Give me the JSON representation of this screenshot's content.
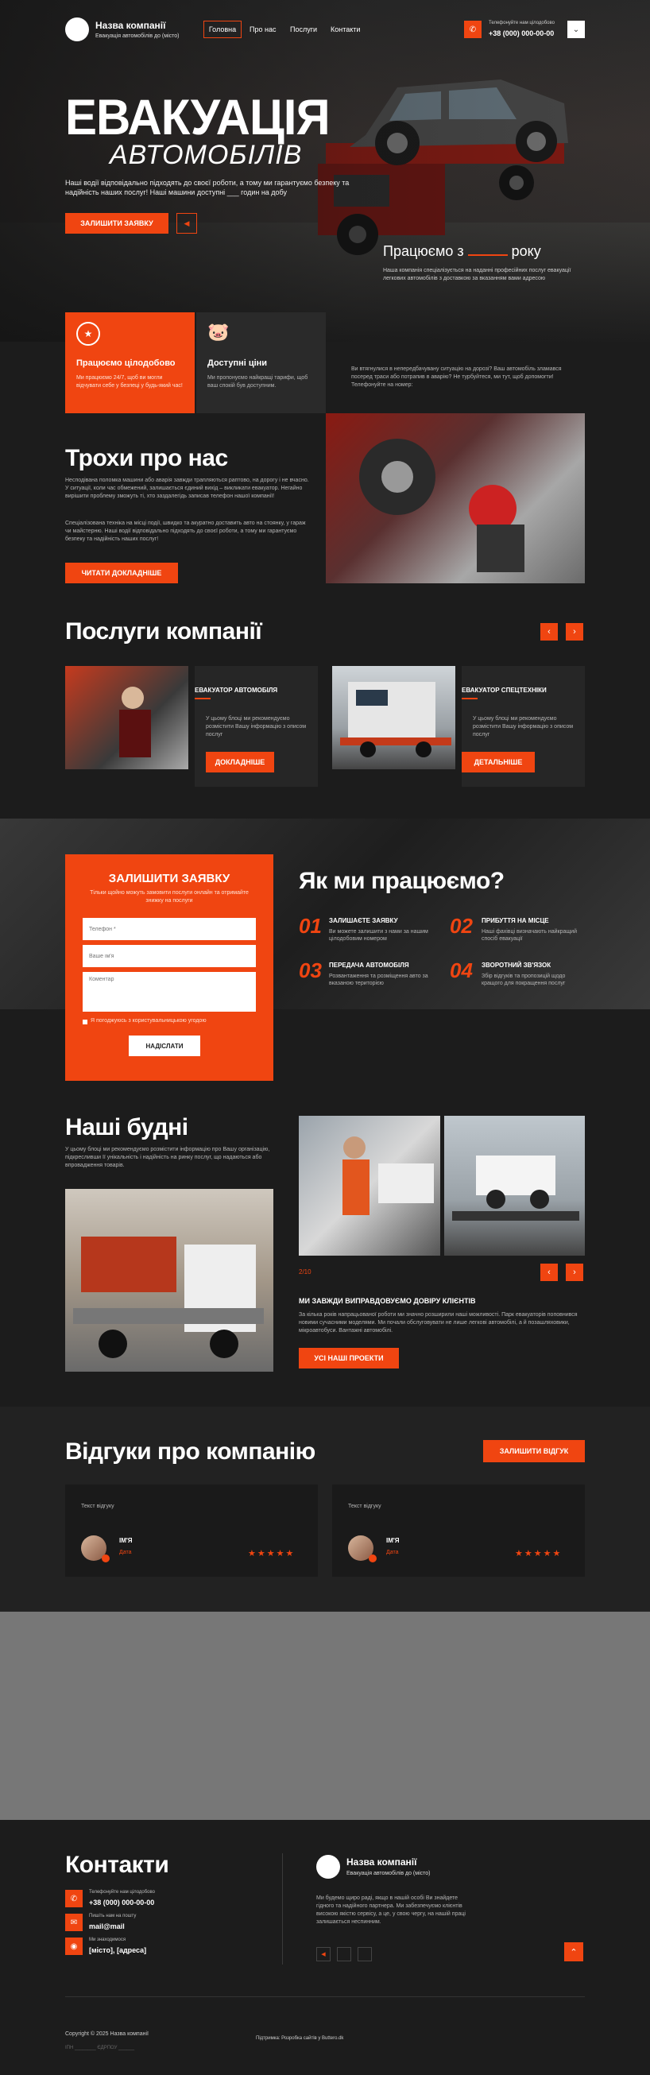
{
  "header": {
    "company": "Назва компанії",
    "tagline": "Евакуація автомобілів до (місто)",
    "nav": [
      "Головна",
      "Про нас",
      "Послуги",
      "Контакти"
    ],
    "phone_label": "Телефонуйте нам цілодобово",
    "phone": "+38 (000) 000-00-00"
  },
  "hero": {
    "title_line1": "ЕВАКУАЦІЯ",
    "title_line2": "АВТОМОБІЛІВ",
    "desc": "Наші водії відповідально підходять до своєї роботи, а тому ми гарантуємо безпеку та надійність наших послуг! Наші машини доступні ___ годин на добу",
    "cta": "ЗАЛИШИТИ ЗАЯВКУ",
    "work_prefix": "Працюємо з",
    "work_suffix": "року",
    "work_desc": "Наша компанія спеціалізується на наданні професійних послуг евакуації легкових автомобілів з доставкою за вказанням вами адресою"
  },
  "features": [
    {
      "title": "Працюємо цілодобово",
      "text": "Ми працюємо 24/7, щоб ви могли відчувати себе у безпеці у будь-який час!"
    },
    {
      "title": "Доступні ціни",
      "text": "Ми пропонуємо найкращі тарифи, щоб ваш спокій був доступним."
    }
  ],
  "features_note": "Ви втягнулися в непередбачувану ситуацію на дорозі? Ваш автомобіль зламався посеред траси або потрапив в аварію? Не турбуйтеся, ми тут, щоб допомогти! Телефонуйте на номер:",
  "about": {
    "title": "Трохи про нас",
    "p1": "Несподівана поломка машини або аварія завжди трапляються раптово, на дорогу і не вчасно. У ситуації, коли час обмежений, залишається єдиний вихід – викликати евакуатор. Негайно вирішити проблему зможуть ті, хто заздалегідь записав телефон нашої компанії!",
    "p2": "Спеціалізована техніка на місці події, швидко та акуратно доставить авто на стоянку, у гараж чи майстерню. Наші водії відповідально підходять до своєї роботи, а тому ми гарантуємо безпеку та надійність наших послуг!",
    "cta": "ЧИТАТИ ДОКЛАДНІШЕ"
  },
  "services": {
    "title": "Послуги компанії",
    "items": [
      {
        "title": "ЕВАКУАТОР АВТОМОБІЛЯ",
        "text": "У цьому блоці ми рекомендуємо розмістити Вашу інформацію з описом послуг",
        "cta": "ДОКЛАДНІШЕ"
      },
      {
        "title": "ЕВАКУАТОР СПЕЦТЕХНІКИ",
        "text": "У цьому блоці ми рекомендуємо розмістити Вашу інформацію з описом послуг",
        "cta": "ДЕТАЛЬНІШЕ"
      }
    ]
  },
  "form": {
    "title": "ЗАЛИШИТИ ЗАЯВКУ",
    "subtitle": "Тільки щойно можуть замовити послуги онлайн та отримайте знижку на послуги",
    "phone_ph": "Телефон *",
    "name_ph": "Ваше ім'я",
    "comment_ph": "Коментар",
    "consent": "Я погоджуюсь з користувальницькою угодою",
    "submit": "НАДІСЛАТИ"
  },
  "how": {
    "title": "Як ми працюємо?",
    "steps": [
      {
        "num": "01",
        "title": "ЗАЛИШАЄТЕ ЗАЯВКУ",
        "text": "Ви можете залишити з нами за нашим цілодобовим номером"
      },
      {
        "num": "02",
        "title": "ПРИБУТТЯ НА МІСЦЕ",
        "text": "Наші фахівці визначають найкращий спосіб евакуації"
      },
      {
        "num": "03",
        "title": "ПЕРЕДАЧА АВТОМОБІЛЯ",
        "text": "Розвантаження та розміщення авто за вказаною територією"
      },
      {
        "num": "04",
        "title": "ЗВОРОТНИЙ ЗВ'ЯЗОК",
        "text": "Збір відгуків та пропозицій щодо кращого для покращення послуг"
      }
    ]
  },
  "life": {
    "title": "Наші будні",
    "text": "У цьому блоці ми рекомендуємо розмістити інформацію про Вашу організацію, підкресливши її унікальність і надійність на ринку послуг, що надаються або впровадження товарів.",
    "counter": "2/10",
    "sub_title": "МИ ЗАВЖДИ ВИПРАВДОВУЄМО ДОВІРУ КЛІЄНТІВ",
    "sub_text": "За кілька років напрацьованої роботи ми значно розширили наші можливості. Парк евакуаторів поповнився новими сучасними моделями. Ми почали обслуговувати не лише легкові автомобілі, а й позашляховики, мікроавтобуси. Вантажні автомобілі.",
    "cta": "УСІ НАШІ ПРОЕКТИ"
  },
  "reviews": {
    "title": "Відгуки про компанію",
    "cta": "ЗАЛИШИТИ ВІДГУК",
    "items": [
      {
        "text": "Текст відгуку",
        "name": "ІМ'Я",
        "date": "Дата",
        "stars": "★★★★★"
      },
      {
        "text": "Текст відгуку",
        "name": "ІМ'Я",
        "date": "Дата",
        "stars": "★★★★★"
      }
    ]
  },
  "contacts": {
    "title": "Контакти",
    "phone_label": "Телефонуйте нам цілодобово",
    "phone": "+38 (000) 000-00-00",
    "mail_label": "Пишіть нам на пошту",
    "mail": "mail@mail",
    "addr_label": "Ми знаходимося",
    "addr": "[місто], [адреса]",
    "company": "Назва компанії",
    "tagline": "Евакуація автомобілів до (місто)",
    "desc": "Ми будемо щиро раді, якщо в нашій особі Ви знайдете гідного та надійного партнера. Ми забезпечуємо клієнтів високою якістю сервісу, а це, у свою чергу, на нашій праці залишається неспинним."
  },
  "footer": {
    "copyright": "Copyright © 2025 Назва компанії",
    "legal": "ІПН ________  ЄДРПОУ ______",
    "support": "Підтримка: Розробка сайтів у Buttero.dk"
  }
}
